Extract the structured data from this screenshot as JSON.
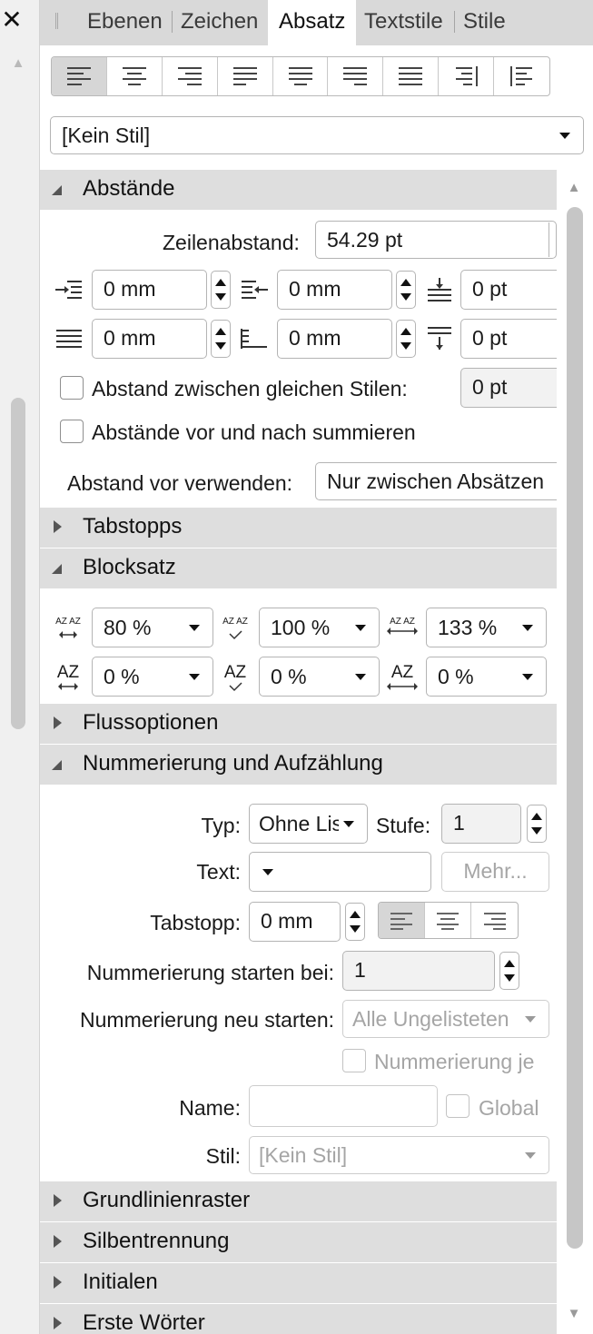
{
  "window": {
    "close_label": "✕"
  },
  "tabs": [
    {
      "label": "Ebenen"
    },
    {
      "label": "Zeichen"
    },
    {
      "label": "Absatz"
    },
    {
      "label": "Textstile"
    },
    {
      "label": "Stile"
    }
  ],
  "paragraph_style": {
    "value": "[Kein Stil]"
  },
  "sections": {
    "abstaende": {
      "title": "Abstände",
      "expanded": true
    },
    "tabstopps": {
      "title": "Tabstopps",
      "expanded": false
    },
    "blocksatz": {
      "title": "Blocksatz",
      "expanded": true
    },
    "flussoptionen": {
      "title": "Flussoptionen",
      "expanded": false
    },
    "nummerierung": {
      "title": "Nummerierung und Aufzählung",
      "expanded": true
    },
    "grundlinienraster": {
      "title": "Grundlinienraster",
      "expanded": false
    },
    "silbentrennung": {
      "title": "Silbentrennung",
      "expanded": false
    },
    "initialen": {
      "title": "Initialen",
      "expanded": false
    },
    "erste_woerter": {
      "title": "Erste Wörter",
      "expanded": false
    }
  },
  "abstaende": {
    "zeilenabstand_label": "Zeilenabstand:",
    "zeilenabstand_value": "54.29 pt",
    "left_indent": "0 mm",
    "right_indent": "0 mm",
    "space_before": "0 pt",
    "first_line_indent": "0 mm",
    "last_line_indent": "0 mm",
    "space_after": "0 pt",
    "same_style_label": "Abstand zwischen gleichen Stilen:",
    "same_style_value": "0 pt",
    "sum_label": "Abstände vor und nach summieren",
    "use_before_label": "Abstand vor verwenden:",
    "use_before_value": "Nur zwischen Absätzen"
  },
  "blocksatz": {
    "word_min": "80 %",
    "word_desired": "100 %",
    "word_max": "133 %",
    "letter_min": "0 %",
    "letter_desired": "0 %",
    "letter_max": "0 %",
    "az": "AZ",
    "azaz": "AZ AZ"
  },
  "nummerierung": {
    "typ_label": "Typ:",
    "typ_value": "Ohne Liste",
    "stufe_label": "Stufe:",
    "stufe_value": "1",
    "text_label": "Text:",
    "mehr_label": "Mehr...",
    "tabstopp_label": "Tabstopp:",
    "tabstopp_value": "0 mm",
    "start_label": "Nummerierung starten bei:",
    "start_value": "1",
    "restart_label": "Nummerierung neu starten:",
    "restart_value": "Alle Ungelisteten",
    "per_label": "Nummerierung je",
    "name_label": "Name:",
    "name_value": "",
    "global_label": "Global",
    "stil_label": "Stil:",
    "stil_value": "[Kein Stil]"
  }
}
